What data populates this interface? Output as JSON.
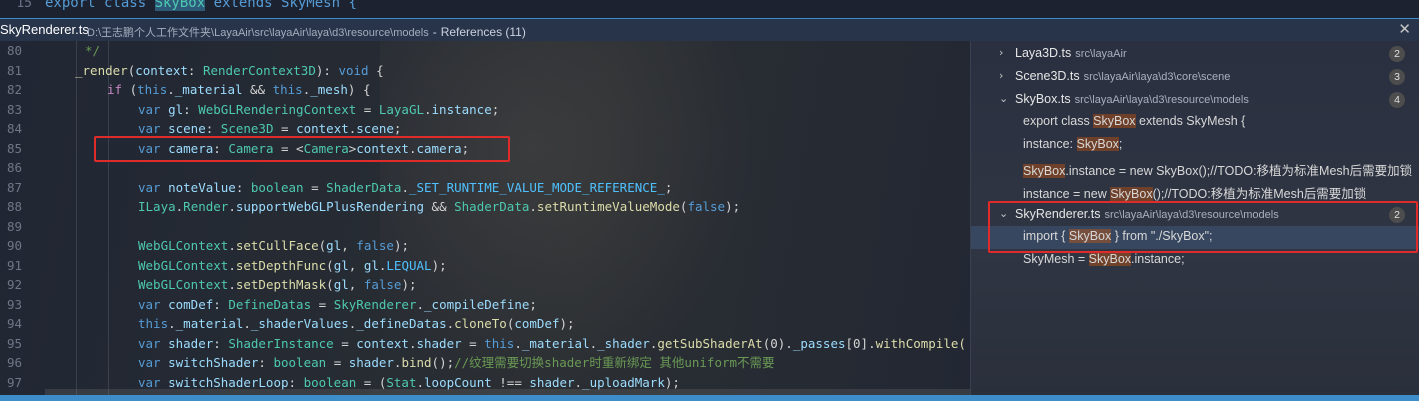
{
  "top_line": {
    "line_number": "15",
    "code_before": "export class ",
    "code_highlight": "SkyBox",
    "code_after": " extends SkyMesh {"
  },
  "peek_header": {
    "file_name": "SkyRenderer.ts",
    "file_path": "D:\\王志鹏个人工作文件夹\\LayaAir\\src\\layaAir\\laya\\d3\\resource\\models",
    "separator": "-",
    "references_label": "References (11)",
    "close_icon": "close-icon"
  },
  "line_numbers": [
    "80",
    "81",
    "82",
    "83",
    "84",
    "85",
    "86",
    "87",
    "88",
    "89",
    "90",
    "91",
    "92",
    "93",
    "94",
    "95",
    "96",
    "97"
  ],
  "code": {
    "l80": "*/",
    "l81": {
      "a": "_render",
      "b": "(",
      "c": "context",
      "d": ": ",
      "e": "RenderContext3D",
      "f": "): ",
      "g": "void",
      "h": " {"
    },
    "l82": {
      "a": "if",
      "b": " (",
      "c": "this",
      "d": ".",
      "e": "_material",
      "f": " && ",
      "g": "this",
      "h": ".",
      "i": "_mesh",
      "j": ") {"
    },
    "l83": {
      "a": "var",
      "b": " gl",
      "c": ": ",
      "d": "WebGLRenderingContext",
      "e": " = ",
      "f": "LayaGL",
      "g": ".",
      "h": "instance",
      "i": ";"
    },
    "l84": {
      "a": "var",
      "b": " scene",
      "c": ": ",
      "d": "Scene3D",
      "e": " = ",
      "f": "context",
      "g": ".",
      "h": "scene",
      "i": ";"
    },
    "l85": {
      "a": "var",
      "b": " camera",
      "c": ": ",
      "d": "Camera",
      "e": " = <",
      "f": "Camera",
      "g": ">",
      "h": "context",
      "i": ".",
      "j": "camera",
      "k": ";"
    },
    "l87": {
      "a": "var",
      "b": " noteValue",
      "c": ": ",
      "d": "boolean",
      "e": " = ",
      "f": "ShaderData",
      "g": ".",
      "h": "_SET_RUNTIME_VALUE_MODE_REFERENCE_",
      "i": ";"
    },
    "l88": {
      "a": "ILaya",
      "b": ".",
      "c": "Render",
      "d": ".",
      "e": "supportWebGLPlusRendering",
      "f": " && ",
      "g": "ShaderData",
      "h": ".",
      "i": "setRuntimeValueMode",
      "j": "(",
      "k": "false",
      "l": ");"
    },
    "l90": {
      "a": "WebGLContext",
      "b": ".",
      "c": "setCullFace",
      "d": "(",
      "e": "gl",
      "f": ", ",
      "g": "false",
      "h": ");"
    },
    "l91": {
      "a": "WebGLContext",
      "b": ".",
      "c": "setDepthFunc",
      "d": "(",
      "e": "gl",
      "f": ", ",
      "g": "gl",
      "h": ".",
      "i": "LEQUAL",
      "j": ");"
    },
    "l92": {
      "a": "WebGLContext",
      "b": ".",
      "c": "setDepthMask",
      "d": "(",
      "e": "gl",
      "f": ", ",
      "g": "false",
      "h": ");"
    },
    "l93": {
      "a": "var",
      "b": " comDef",
      "c": ": ",
      "d": "DefineDatas",
      "e": " = ",
      "f": "SkyRenderer",
      "g": ".",
      "h": "_compileDefine",
      "i": ";"
    },
    "l94": {
      "a": "this",
      "b": ".",
      "c": "_material",
      "d": ".",
      "e": "_shaderValues",
      "f": ".",
      "g": "_defineDatas",
      "h": ".",
      "i": "cloneTo",
      "j": "(",
      "k": "comDef",
      "l": ");"
    },
    "l95": {
      "a": "var",
      "b": " shader",
      "c": ": ",
      "d": "ShaderInstance",
      "e": " = ",
      "f": "context",
      "g": ".",
      "h": "shader",
      "i": " = ",
      "j": "this",
      "k": ".",
      "l": "_material",
      "m": ".",
      "n": "_shader",
      "o": ".",
      "p": "getSubShaderAt",
      "q": "(0).",
      "r": "_passes",
      "s": "[0].",
      "t": "withCompile("
    },
    "l96": {
      "a": "var",
      "b": " switchShader",
      "c": ": ",
      "d": "boolean",
      "e": " = ",
      "f": "shader",
      "g": ".",
      "h": "bind",
      "i": "();",
      "j": "//纹理需要切换shader时重新绑定 其他uniform不需要"
    },
    "l97": {
      "a": "var",
      "b": " switchShaderLoop",
      "c": ": ",
      "d": "boolean",
      "e": " = (",
      "f": "Stat",
      "g": ".",
      "h": "loopCount",
      "i": " !== ",
      "j": "shader",
      "k": ".",
      "l": "_uploadMark",
      "m": ");"
    }
  },
  "references": {
    "files": [
      {
        "name": "Laya3D.ts",
        "path": "src\\layaAir",
        "count": "2",
        "expanded": false
      },
      {
        "name": "Scene3D.ts",
        "path": "src\\layaAir\\laya\\d3\\core\\scene",
        "count": "3",
        "expanded": false
      },
      {
        "name": "SkyBox.ts",
        "path": "src\\layaAir\\laya\\d3\\resource\\models",
        "count": "4",
        "expanded": true
      },
      {
        "name": "SkyRenderer.ts",
        "path": "src\\layaAir\\laya\\d3\\resource\\models",
        "count": "2",
        "expanded": true
      }
    ],
    "skybox_refs": [
      {
        "pre": "export class ",
        "hl": "SkyBox",
        "post": " extends SkyMesh {"
      },
      {
        "pre": "instance: ",
        "hl": "SkyBox",
        "post": ";"
      },
      {
        "pre": "",
        "hl": "SkyBox",
        "post": ".instance = new SkyBox();//TODO:移植为标准Mesh后需要加锁"
      },
      {
        "pre": "instance = new ",
        "hl": "SkyBox",
        "post": "();//TODO:移植为标准Mesh后需要加锁"
      }
    ],
    "skyrenderer_refs": [
      {
        "pre": "import { ",
        "hl": "SkyBox",
        "post": " } from \"./SkyBox\";"
      },
      {
        "pre": "SkyMesh = ",
        "hl": "SkyBox",
        "post": ".instance;"
      }
    ]
  },
  "colors": {
    "annotation_box": "#e02b2b",
    "selection": "#37475f",
    "accent": "#3c8dc9"
  }
}
